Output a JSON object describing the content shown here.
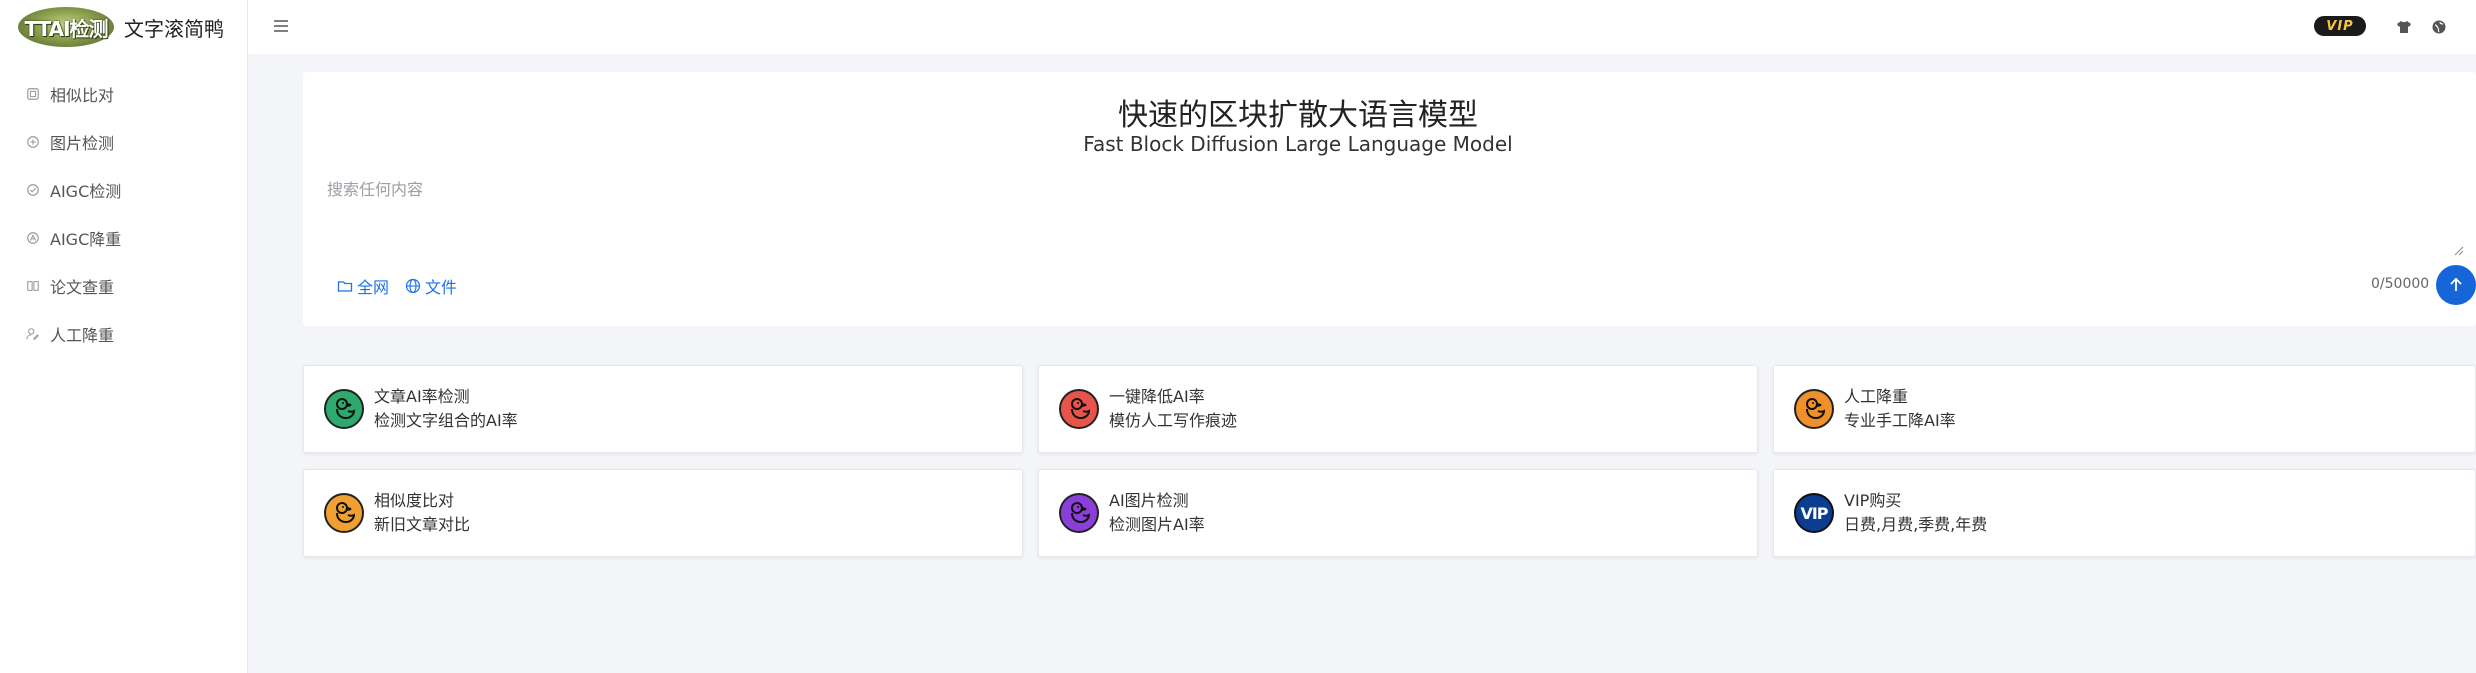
{
  "brand": {
    "logo_text": "TTAI检测",
    "name": "文字滚简鸭"
  },
  "sidebar": {
    "items": [
      {
        "label": "相似比对",
        "icon": "compare-icon"
      },
      {
        "label": "图片检测",
        "icon": "image-check-icon"
      },
      {
        "label": "AIGC检测",
        "icon": "aigc-check-icon"
      },
      {
        "label": "AIGC降重",
        "icon": "aigc-reduce-icon"
      },
      {
        "label": "论文查重",
        "icon": "book-icon"
      },
      {
        "label": "人工降重",
        "icon": "user-edit-icon"
      }
    ]
  },
  "topbar": {
    "vip_label": "VIP",
    "icons": [
      "shirt-icon",
      "globe-icon"
    ]
  },
  "search": {
    "title": "快速的区块扩散大语言模型",
    "subtitle": "Fast Block Diffusion Large Language Model",
    "placeholder": "搜索任何内容",
    "scope_web": "全网",
    "scope_file": "文件",
    "counter": "0/50000"
  },
  "cards": [
    {
      "title": "文章AI率检测",
      "desc": "检测文字组合的AI率",
      "color": "#2eaa6e"
    },
    {
      "title": "一键降低AI率",
      "desc": "模仿人工写作痕迹",
      "color": "#e8544a"
    },
    {
      "title": "人工降重",
      "desc": "专业手工降AI率",
      "color": "#f0902a"
    },
    {
      "title": "相似度比对",
      "desc": "新旧文章对比",
      "color": "#f0a030"
    },
    {
      "title": "AI图片检测",
      "desc": "检测图片AI率",
      "color": "#8a3fd8"
    },
    {
      "title": "VIP购买",
      "desc": "日费,月费,季费,年费",
      "vip_text": "VIP",
      "color": "#0b3d91"
    }
  ],
  "colors": {
    "accent": "#1766d9",
    "link": "#1a73e8"
  }
}
